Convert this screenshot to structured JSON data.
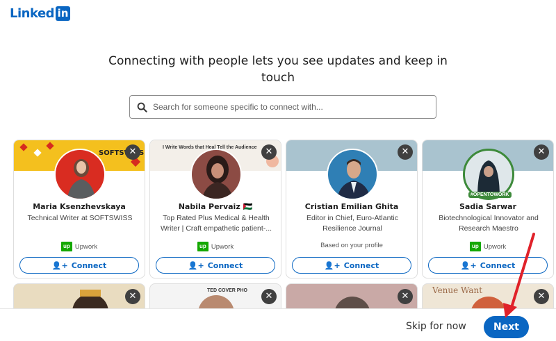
{
  "brand": {
    "logo_text": "Linked",
    "logo_box": "in"
  },
  "headline": "Connecting with people lets you see updates and keep in touch",
  "search": {
    "placeholder": "Search for someone specific to connect with..."
  },
  "cards": [
    {
      "name": "Maria Ksenzhevskaya",
      "headline": "Technical Writer at SOFTSWISS",
      "meta": "Upwork",
      "meta_icon": "upwork-logo",
      "banner_text": "SOFTSWISS",
      "connect_label": "Connect"
    },
    {
      "name": "Nabila Pervaiz 🇵🇸",
      "headline": "Top Rated Plus Medical & Health Writer | Craft empathetic patient-...",
      "meta": "Upwork",
      "meta_icon": "upwork-logo",
      "banner_text": "I Write Words that Heal Tell the Audience",
      "connect_label": "Connect"
    },
    {
      "name": "Cristian Emilian Ghita",
      "headline": "Editor in Chief, Euro-Atlantic Resilience Journal",
      "meta": "Based on your profile",
      "connect_label": "Connect"
    },
    {
      "name": "Sadia Sarwar",
      "headline": "Biotechnological Innovator and Research Maestro",
      "meta": "Upwork",
      "meta_icon": "upwork-logo",
      "badge": "#OPENTOWORK",
      "connect_label": "Connect"
    }
  ],
  "upwork_logo_text": "up",
  "row2_banner_texts": [
    "",
    "TED COVER PHO",
    "",
    "Venue Want"
  ],
  "dismiss_glyph": "✕",
  "footer": {
    "skip_label": "Skip for now",
    "next_label": "Next"
  },
  "colors": {
    "accent": "#0a66c2",
    "upwork": "#14a800",
    "annotation_arrow": "#e0222a"
  }
}
